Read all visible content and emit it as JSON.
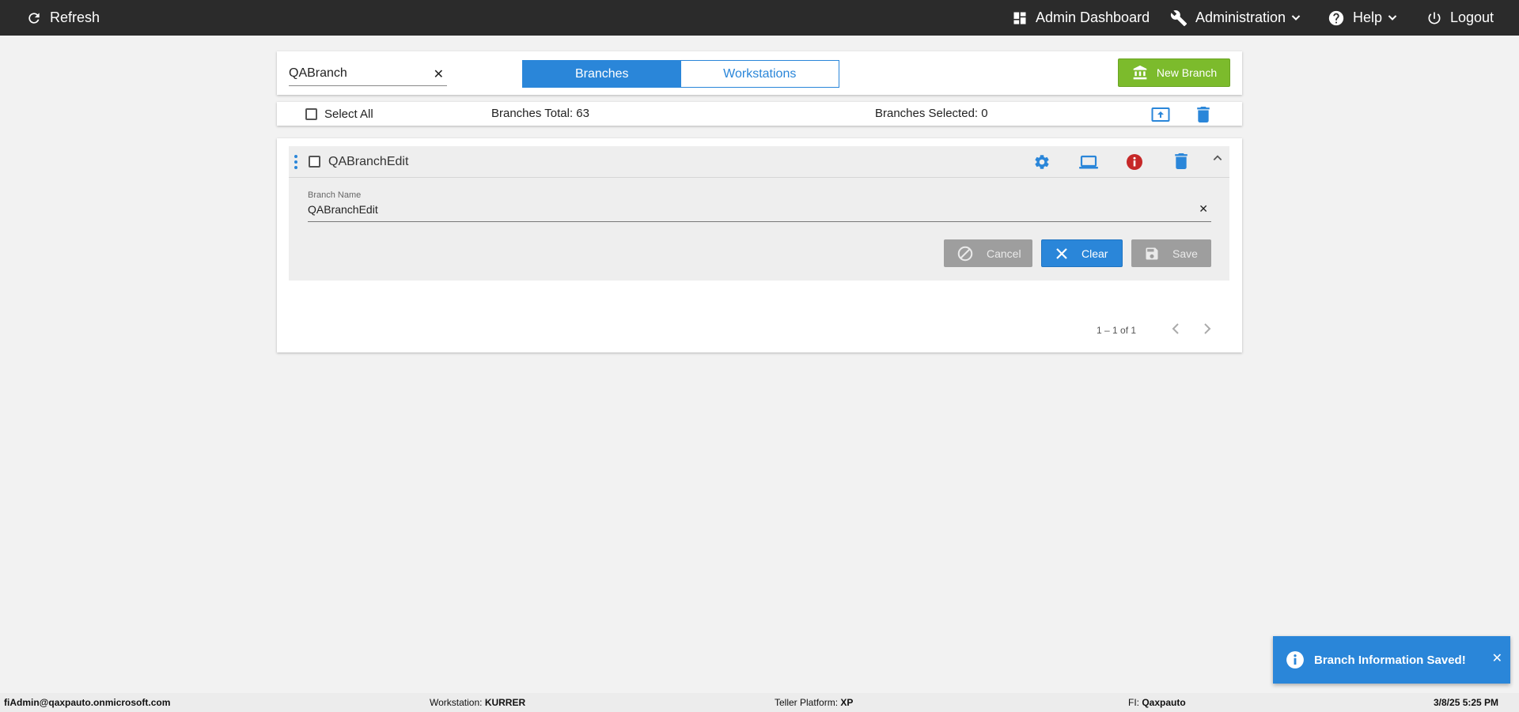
{
  "topbar": {
    "refresh_label": "Refresh",
    "dashboard_label": "Admin Dashboard",
    "administration_label": "Administration",
    "help_label": "Help",
    "logout_label": "Logout"
  },
  "search": {
    "value": "QABranch",
    "clear_glyph": "✕"
  },
  "tabs": [
    {
      "label": "Branches",
      "active": true
    },
    {
      "label": "Workstations",
      "active": false
    }
  ],
  "new_branch_label": "New Branch",
  "summary": {
    "select_all_label": "Select All",
    "total_label": "Branches Total: 63",
    "selected_label": "Branches Selected: 0"
  },
  "branch_row": {
    "name": "QABranchEdit",
    "field_label": "Branch Name",
    "field_value": "QABranchEdit",
    "field_clear_glyph": "✕",
    "cancel_label": "Cancel",
    "clear_label": "Clear",
    "save_label": "Save"
  },
  "pager": {
    "range_text": "1 – 1 of 1"
  },
  "toast": {
    "message": "Branch Information Saved!",
    "close_glyph": "✕"
  },
  "footer": {
    "user": "fiAdmin@qaxpauto.onmicrosoft.com",
    "workstation_label": "Workstation:",
    "workstation_value": "KURRER",
    "platform_label": "Teller Platform:",
    "platform_value": "XP",
    "fi_label": "FI:",
    "fi_value": "Qaxpauto",
    "datetime": "3/8/25 5:25 PM"
  },
  "colors": {
    "accent": "#2a86d9",
    "new_button": "#7cbb2c",
    "info_red": "#c62828",
    "topbar": "#2b2b2b"
  }
}
